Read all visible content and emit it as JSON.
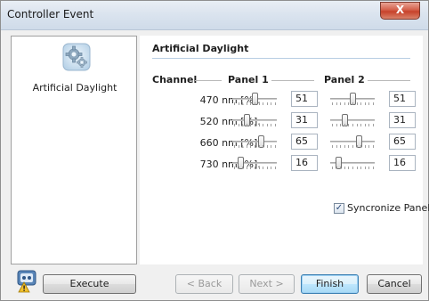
{
  "window": {
    "title": "Controller Event",
    "close_glyph": "X"
  },
  "left": {
    "icon": "gear-icon",
    "label": "Artificial Daylight"
  },
  "panel": {
    "heading": "Artificial Daylight",
    "col_channel": "Channel",
    "col_panel1": "Panel 1",
    "col_panel2": "Panel 2",
    "rows": [
      {
        "label": "470 nm [%]:",
        "panel1": "51",
        "panel2": "51",
        "panel1_fraction": 0.51,
        "panel2_fraction": 0.51
      },
      {
        "label": "520 nm [%]:",
        "panel1": "31",
        "panel2": "31",
        "panel1_fraction": 0.31,
        "panel2_fraction": 0.31
      },
      {
        "label": "660 nm [%]:",
        "panel1": "65",
        "panel2": "65",
        "panel1_fraction": 0.65,
        "panel2_fraction": 0.65
      },
      {
        "label": "730 nm [%]:",
        "panel1": "16",
        "panel2": "16",
        "panel1_fraction": 0.16,
        "panel2_fraction": 0.16
      }
    ],
    "sync": {
      "label": "Syncronize Panels",
      "checked": true,
      "glyph": "✓"
    }
  },
  "buttons": {
    "execute": "Execute",
    "back": "< Back",
    "next": "Next >",
    "finish": "Finish",
    "cancel": "Cancel"
  },
  "status": {
    "icon": "warning-robot-icon"
  }
}
